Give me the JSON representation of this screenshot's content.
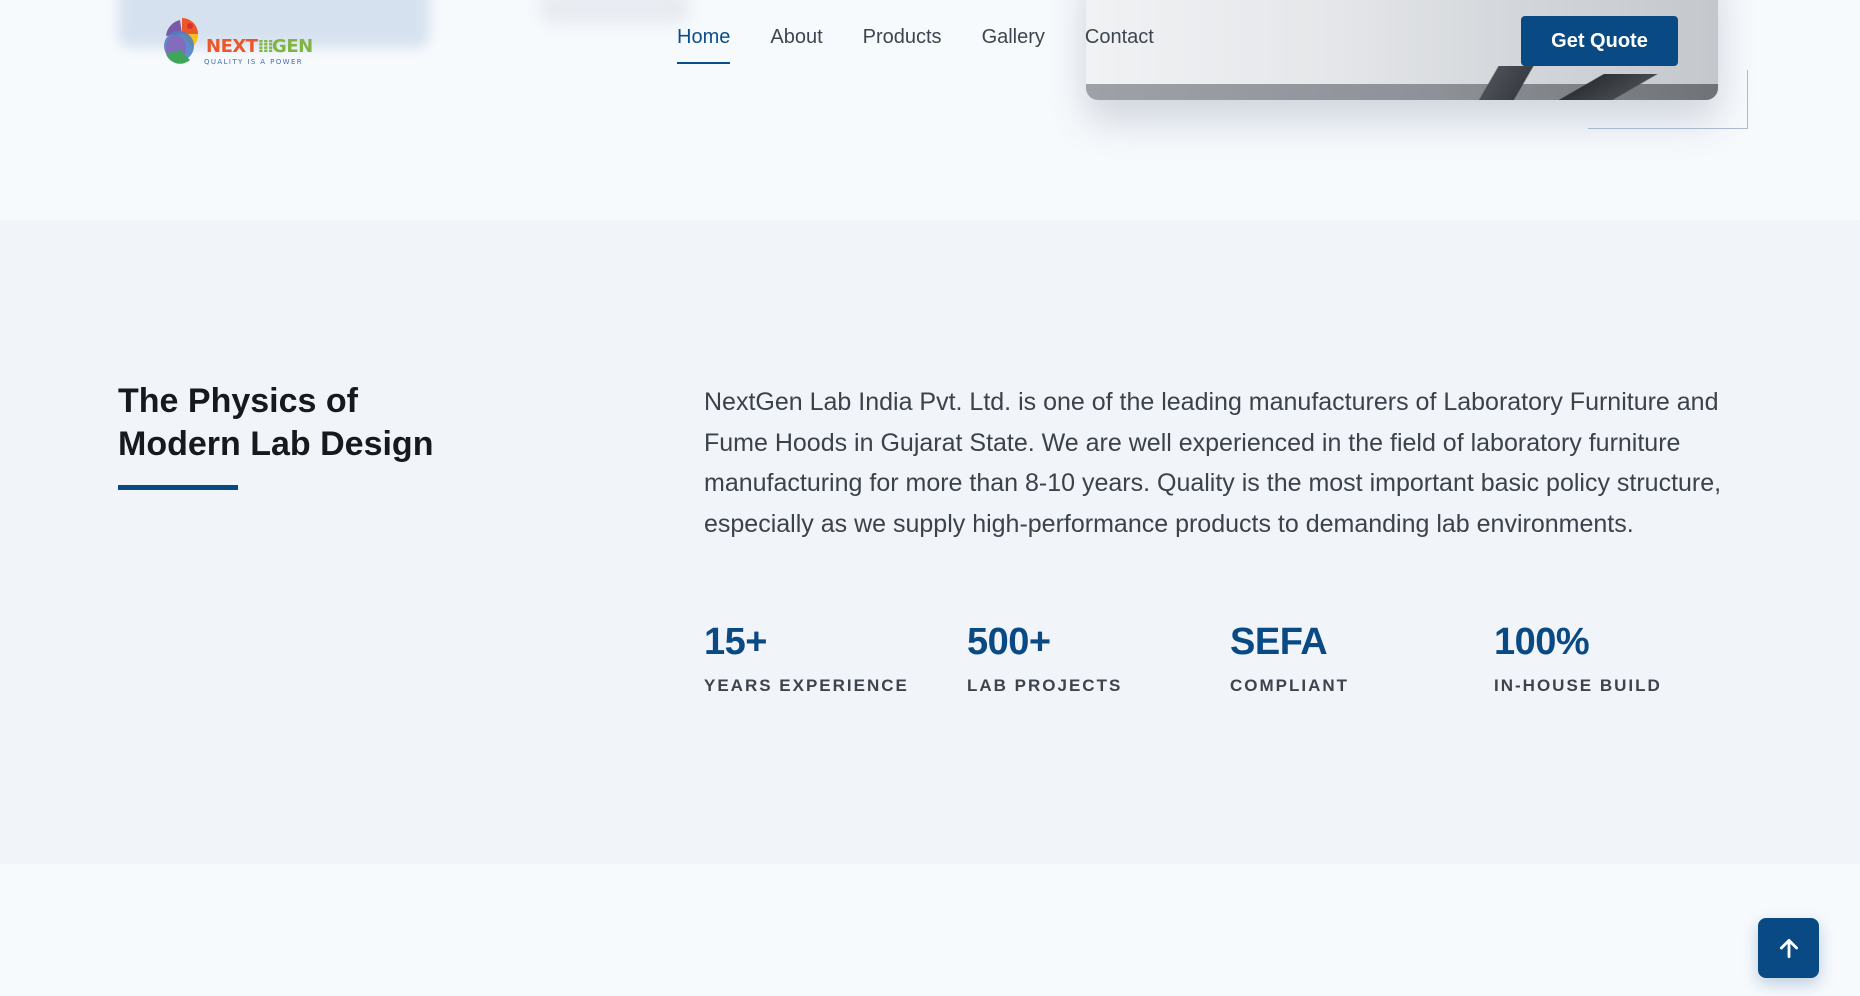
{
  "brand": {
    "logo_main_1": "NEXT",
    "logo_main_2": "GEN",
    "logo_tagline": "QUALITY IS A POWER"
  },
  "nav": {
    "items": [
      {
        "label": "Home",
        "active": true
      },
      {
        "label": "About",
        "active": false
      },
      {
        "label": "Products",
        "active": false
      },
      {
        "label": "Gallery",
        "active": false
      },
      {
        "label": "Contact",
        "active": false
      }
    ],
    "cta_label": "Get Quote"
  },
  "about": {
    "title_line1": "The Physics of",
    "title_line2": "Modern Lab Design",
    "body": "NextGen Lab India Pvt. Ltd. is one of the leading manufacturers of Laboratory Furniture and Fume Hoods in Gujarat State. We are well experienced in the field of laboratory furniture manufacturing for more than 8-10 years. Quality is the most important basic policy structure, especially as we supply high-performance products to demanding lab environments.",
    "stats": [
      {
        "value": "15+",
        "label": "YEARS EXPERIENCE"
      },
      {
        "value": "500+",
        "label": "LAB PROJECTS"
      },
      {
        "value": "SEFA",
        "label": "COMPLIANT"
      },
      {
        "value": "100%",
        "label": "IN-HOUSE BUILD"
      }
    ]
  },
  "icons": {
    "back_to_top": "arrow-up-icon"
  },
  "colors": {
    "primary": "#0a4a84",
    "section_bg": "#f1f4f8",
    "page_bg": "#f7fafd",
    "logo_orange": "#e9572a",
    "logo_green": "#7fb544"
  }
}
